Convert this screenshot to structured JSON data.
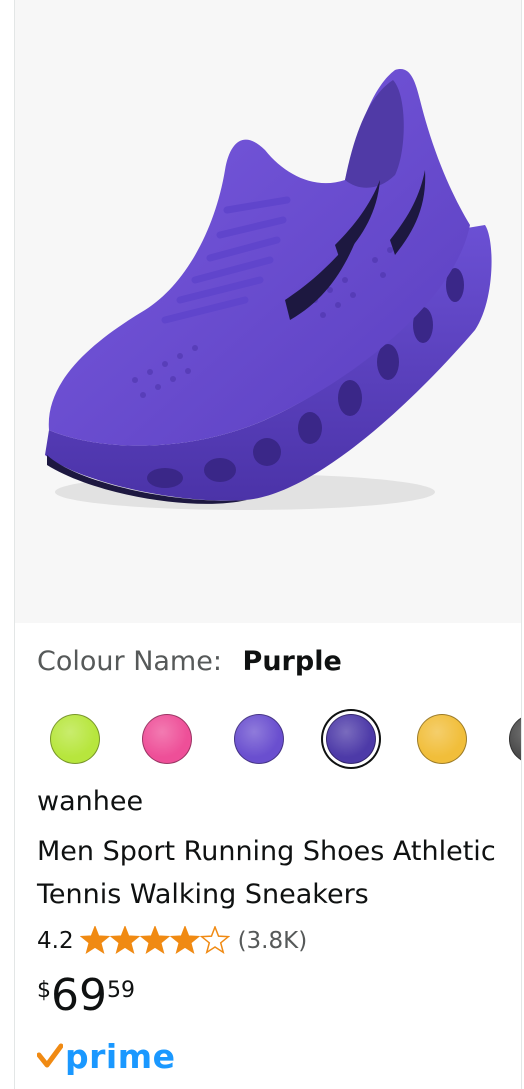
{
  "product": {
    "colour_label": "Colour Name:",
    "colour_value": "Purple",
    "brand": "wanhee",
    "title": "Men Sport Running Shoes Athletic Tennis Walking Sneakers",
    "rating": "4.2",
    "rating_value": 4.2,
    "review_count": "(3.8K)",
    "price_symbol": "$",
    "price_whole": "69",
    "price_fraction": "59",
    "prime_label": "prime"
  },
  "swatches": [
    {
      "name": "lime",
      "color": "#b7e63d"
    },
    {
      "name": "pink",
      "color": "#ee4f98"
    },
    {
      "name": "light-purple",
      "color": "#6a4fcf"
    },
    {
      "name": "purple",
      "color": "#4d3aa8",
      "selected": true
    },
    {
      "name": "yellow",
      "color": "#f1be3a"
    },
    {
      "name": "dark-grey",
      "color": "#4a4a4a"
    }
  ],
  "colors": {
    "star": "#f08a13",
    "prime_blue": "#1a98ff",
    "prime_check": "#f08a13",
    "shoe": "#6a4fcf"
  }
}
